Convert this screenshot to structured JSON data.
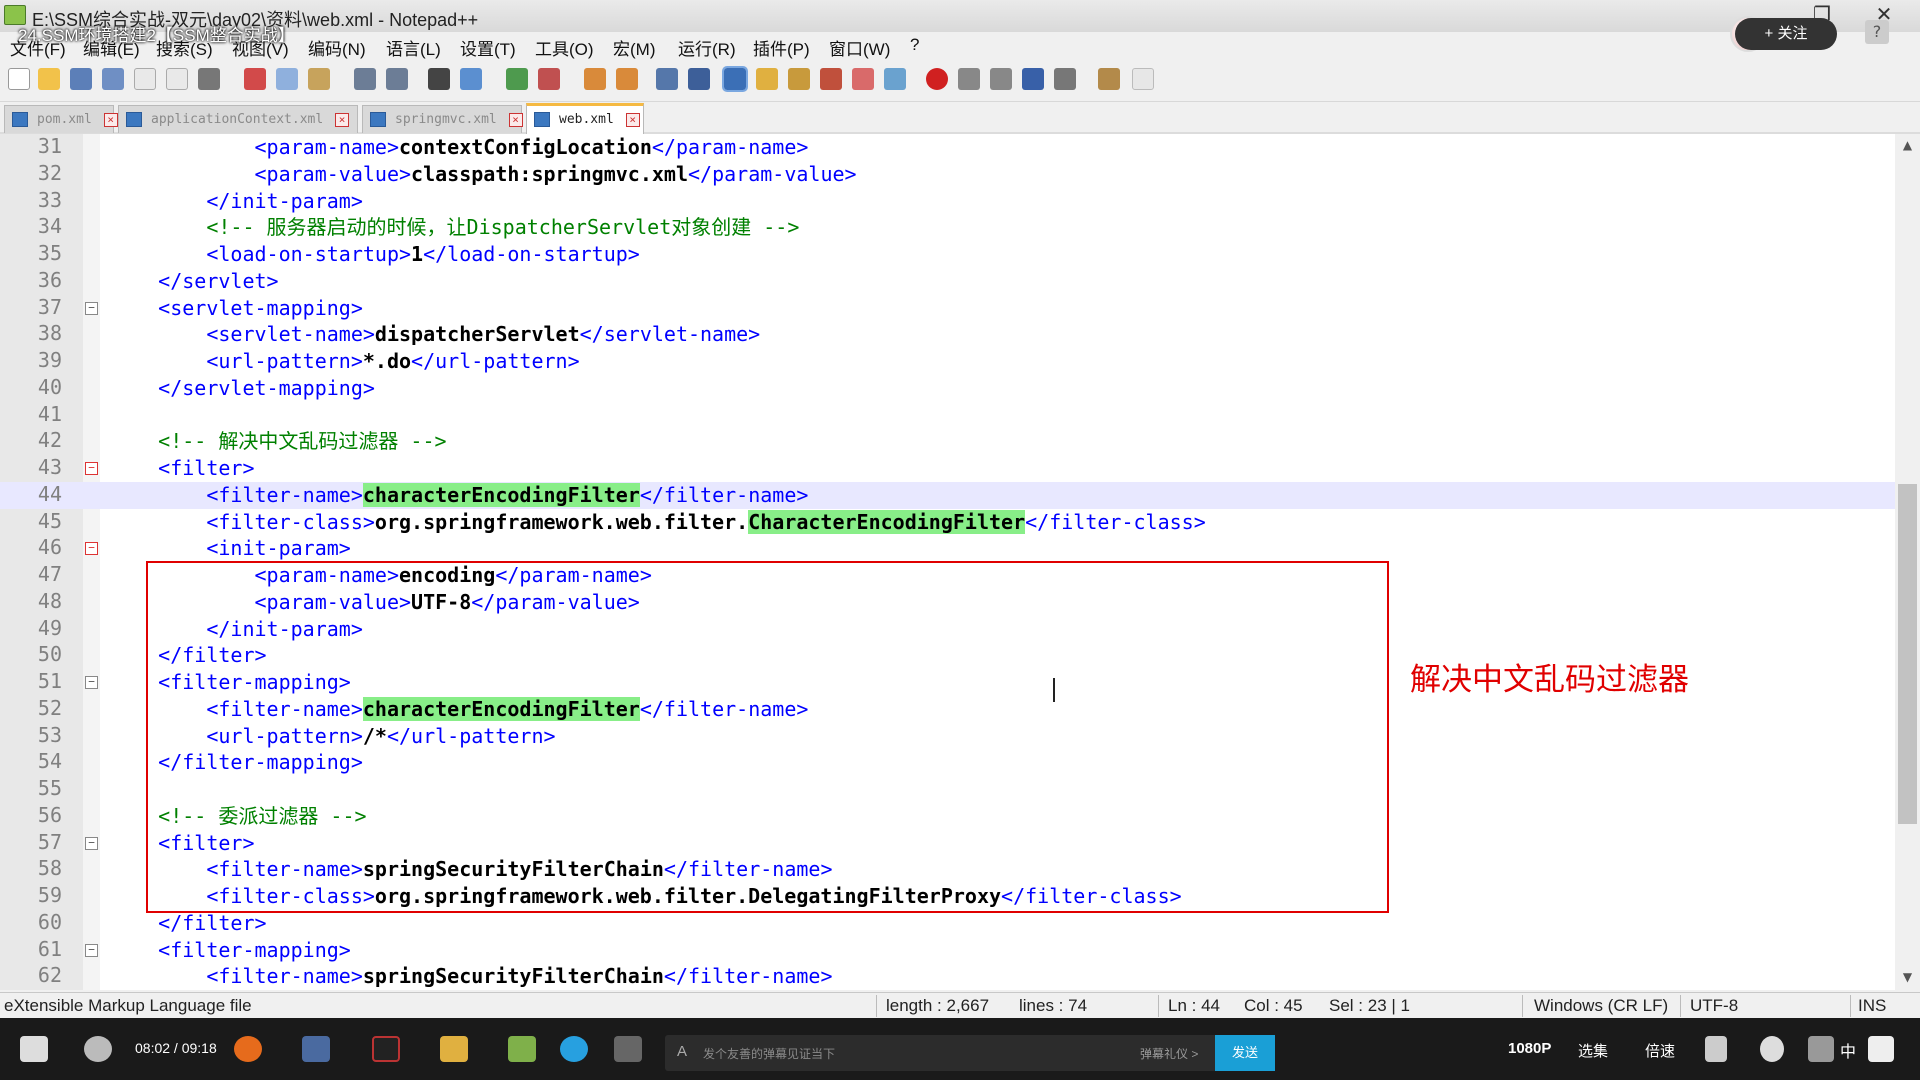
{
  "window": {
    "title": "E:\\SSM综合实战-双元\\day02\\资料\\web.xml - Notepad++",
    "video_title": "24.SSM环境搭建2【SSM整合实战】",
    "follow_label": "+ 关注",
    "help_label": "?",
    "close_glyph": "✕",
    "restore_glyph": "❐"
  },
  "menubar": [
    "文件(F)",
    "编辑(E)",
    "搜索(S)",
    "视图(V)",
    "编码(N)",
    "语言(L)",
    "设置(T)",
    "工具(O)",
    "宏(M)",
    "运行(R)",
    "插件(P)",
    "窗口(W)",
    "?"
  ],
  "tabs": [
    {
      "label": "pom.xml",
      "active": false
    },
    {
      "label": "applicationContext.xml",
      "active": false
    },
    {
      "label": "springmvc.xml",
      "active": false
    },
    {
      "label": "web.xml",
      "active": true
    }
  ],
  "editor": {
    "lines": [
      {
        "n": "31",
        "parts": [
          [
            "i",
            "            "
          ],
          [
            "t",
            "<param-name>"
          ],
          [
            "x",
            "contextConfigLocation"
          ],
          [
            "t",
            "</param-name>"
          ]
        ]
      },
      {
        "n": "32",
        "parts": [
          [
            "i",
            "            "
          ],
          [
            "t",
            "<param-value>"
          ],
          [
            "x",
            "classpath:springmvc.xml"
          ],
          [
            "t",
            "</param-value>"
          ]
        ]
      },
      {
        "n": "33",
        "parts": [
          [
            "i",
            "        "
          ],
          [
            "t",
            "</init-param>"
          ]
        ]
      },
      {
        "n": "34",
        "parts": [
          [
            "i",
            "        "
          ],
          [
            "c",
            "<!-- 服务器启动的时候，让DispatcherServlet对象创建 -->"
          ]
        ]
      },
      {
        "n": "35",
        "parts": [
          [
            "i",
            "        "
          ],
          [
            "t",
            "<load-on-startup>"
          ],
          [
            "x",
            "1"
          ],
          [
            "t",
            "</load-on-startup>"
          ]
        ]
      },
      {
        "n": "36",
        "parts": [
          [
            "i",
            "    "
          ],
          [
            "t",
            "</servlet>"
          ]
        ]
      },
      {
        "n": "37",
        "parts": [
          [
            "i",
            "    "
          ],
          [
            "t",
            "<servlet-mapping>"
          ]
        ]
      },
      {
        "n": "38",
        "parts": [
          [
            "i",
            "        "
          ],
          [
            "t",
            "<servlet-name>"
          ],
          [
            "x",
            "dispatcherServlet"
          ],
          [
            "t",
            "</servlet-name>"
          ]
        ]
      },
      {
        "n": "39",
        "parts": [
          [
            "i",
            "        "
          ],
          [
            "t",
            "<url-pattern>"
          ],
          [
            "x",
            "*.do"
          ],
          [
            "t",
            "</url-pattern>"
          ]
        ]
      },
      {
        "n": "40",
        "parts": [
          [
            "i",
            "    "
          ],
          [
            "t",
            "</servlet-mapping>"
          ]
        ]
      },
      {
        "n": "41",
        "parts": []
      },
      {
        "n": "42",
        "parts": [
          [
            "i",
            "    "
          ],
          [
            "c",
            "<!-- 解决中文乱码过滤器 -->"
          ]
        ]
      },
      {
        "n": "43",
        "parts": [
          [
            "i",
            "    "
          ],
          [
            "t",
            "<filter>"
          ]
        ]
      },
      {
        "n": "44",
        "parts": [
          [
            "i",
            "        "
          ],
          [
            "t",
            "<filter-name>"
          ],
          [
            "h",
            "characterEncodingFilter"
          ],
          [
            "t",
            "</filter-name>"
          ]
        ]
      },
      {
        "n": "45",
        "parts": [
          [
            "i",
            "        "
          ],
          [
            "t",
            "<filter-class>"
          ],
          [
            "x",
            "org.springframework.web.filter."
          ],
          [
            "h",
            "CharacterEncodingFilter"
          ],
          [
            "t",
            "</filter-class>"
          ]
        ]
      },
      {
        "n": "46",
        "parts": [
          [
            "i",
            "        "
          ],
          [
            "t",
            "<init-param>"
          ]
        ]
      },
      {
        "n": "47",
        "parts": [
          [
            "i",
            "            "
          ],
          [
            "t",
            "<param-name>"
          ],
          [
            "x",
            "encoding"
          ],
          [
            "t",
            "</param-name>"
          ]
        ]
      },
      {
        "n": "48",
        "parts": [
          [
            "i",
            "            "
          ],
          [
            "t",
            "<param-value>"
          ],
          [
            "x",
            "UTF-8"
          ],
          [
            "t",
            "</param-value>"
          ]
        ]
      },
      {
        "n": "49",
        "parts": [
          [
            "i",
            "        "
          ],
          [
            "t",
            "</init-param>"
          ]
        ]
      },
      {
        "n": "50",
        "parts": [
          [
            "i",
            "    "
          ],
          [
            "t",
            "</filter>"
          ]
        ]
      },
      {
        "n": "51",
        "parts": [
          [
            "i",
            "    "
          ],
          [
            "t",
            "<filter-mapping>"
          ]
        ]
      },
      {
        "n": "52",
        "parts": [
          [
            "i",
            "        "
          ],
          [
            "t",
            "<filter-name>"
          ],
          [
            "h",
            "characterEncodingFilter"
          ],
          [
            "t",
            "</filter-name>"
          ]
        ]
      },
      {
        "n": "53",
        "parts": [
          [
            "i",
            "        "
          ],
          [
            "t",
            "<url-pattern>"
          ],
          [
            "x",
            "/*"
          ],
          [
            "t",
            "</url-pattern>"
          ]
        ]
      },
      {
        "n": "54",
        "parts": [
          [
            "i",
            "    "
          ],
          [
            "t",
            "</filter-mapping>"
          ]
        ]
      },
      {
        "n": "55",
        "parts": []
      },
      {
        "n": "56",
        "parts": [
          [
            "i",
            "    "
          ],
          [
            "c",
            "<!-- 委派过滤器 -->"
          ]
        ]
      },
      {
        "n": "57",
        "parts": [
          [
            "i",
            "    "
          ],
          [
            "t",
            "<filter>"
          ]
        ]
      },
      {
        "n": "58",
        "parts": [
          [
            "i",
            "        "
          ],
          [
            "t",
            "<filter-name>"
          ],
          [
            "x",
            "springSecurityFilterChain"
          ],
          [
            "t",
            "</filter-name>"
          ]
        ]
      },
      {
        "n": "59",
        "parts": [
          [
            "i",
            "        "
          ],
          [
            "t",
            "<filter-class>"
          ],
          [
            "x",
            "org.springframework.web.filter.DelegatingFilterProxy"
          ],
          [
            "t",
            "</filter-class>"
          ]
        ]
      },
      {
        "n": "60",
        "parts": [
          [
            "i",
            "    "
          ],
          [
            "t",
            "</filter>"
          ]
        ]
      },
      {
        "n": "61",
        "parts": [
          [
            "i",
            "    "
          ],
          [
            "t",
            "<filter-mapping>"
          ]
        ]
      },
      {
        "n": "62",
        "parts": [
          [
            "i",
            "        "
          ],
          [
            "t",
            "<filter-name>"
          ],
          [
            "x",
            "springSecurityFilterChain"
          ],
          [
            "t",
            "</filter-name>"
          ]
        ]
      }
    ],
    "current_line": "44",
    "annotation": "解决中文乱码过滤器"
  },
  "statusbar": {
    "file_type": "eXtensible Markup Language file",
    "length": "length : 2,667",
    "lines": "lines : 74",
    "ln": "Ln : 44",
    "col": "Col : 45",
    "sel": "Sel : 23 | 1",
    "eol": "Windows (CR LF)",
    "encoding": "UTF-8",
    "mode": "INS"
  },
  "player": {
    "time": "08:02 / 09:18",
    "danmaku_placeholder": "发个友善的弹幕见证当下",
    "danmaku_etiquette": "弹幕礼仪 >",
    "send_label": "发送",
    "quality": "1080P",
    "episodes": "选集",
    "speed": "倍速",
    "subtitle_lang": "中"
  },
  "colors": {
    "tag": "#0000ff",
    "comment": "#008000",
    "highlight": "#88ee88",
    "annotation_red": "#e00000",
    "current_line": "#e8e8ff"
  }
}
